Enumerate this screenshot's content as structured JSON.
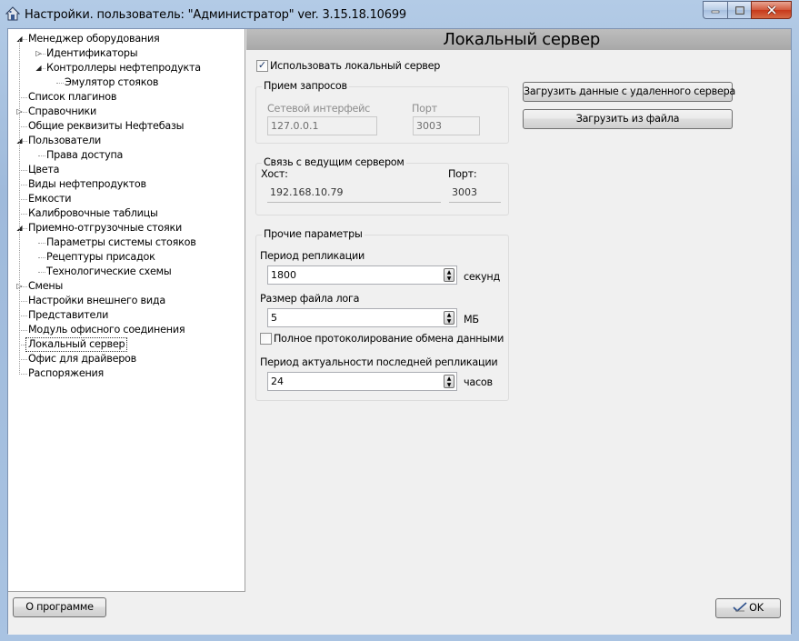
{
  "window": {
    "title": "Настройки. пользователь: \"Администратор\" ver. 3.15.18.10699"
  },
  "tree": [
    {
      "label": "Менеджер оборудования",
      "level": 0,
      "exp": "open"
    },
    {
      "label": "Идентификаторы",
      "level": 1,
      "exp": "closed"
    },
    {
      "label": "Контроллеры нефтепродукта",
      "level": 1,
      "exp": "open"
    },
    {
      "label": "Эмулятор стояков",
      "level": 2,
      "exp": ""
    },
    {
      "label": "Список плагинов",
      "level": 0,
      "exp": ""
    },
    {
      "label": "Справочники",
      "level": 0,
      "exp": "closed"
    },
    {
      "label": "Общие реквизиты Нефтебазы",
      "level": 0,
      "exp": ""
    },
    {
      "label": "Пользователи",
      "level": 0,
      "exp": "open"
    },
    {
      "label": "Права доступа",
      "level": 1,
      "exp": ""
    },
    {
      "label": "Цвета",
      "level": 0,
      "exp": ""
    },
    {
      "label": "Виды нефтепродуктов",
      "level": 0,
      "exp": ""
    },
    {
      "label": "Емкости",
      "level": 0,
      "exp": ""
    },
    {
      "label": "Калибровочные таблицы",
      "level": 0,
      "exp": ""
    },
    {
      "label": "Приемно-отгрузочные стояки",
      "level": 0,
      "exp": "open"
    },
    {
      "label": "Параметры системы стояков",
      "level": 1,
      "exp": ""
    },
    {
      "label": "Рецептуры присадок",
      "level": 1,
      "exp": ""
    },
    {
      "label": "Технологические схемы",
      "level": 1,
      "exp": ""
    },
    {
      "label": "Смены",
      "level": 0,
      "exp": "closed"
    },
    {
      "label": "Настройки внешнего вида",
      "level": 0,
      "exp": ""
    },
    {
      "label": "Представители",
      "level": 0,
      "exp": ""
    },
    {
      "label": "Модуль офисного соединения",
      "level": 0,
      "exp": ""
    },
    {
      "label": "Локальный сервер",
      "level": 0,
      "exp": "",
      "selected": true
    },
    {
      "label": "Офис для драйверов",
      "level": 0,
      "exp": ""
    },
    {
      "label": "Распоряжения",
      "level": 0,
      "exp": ""
    }
  ],
  "panel": {
    "title": "Локальный сервер",
    "use_local": {
      "label": "Использовать локальный сервер",
      "checked": true
    },
    "requests": {
      "legend": "Прием запросов",
      "iface_label": "Сетевой интерфейс",
      "iface_value": "127.0.0.1",
      "port_label": "Порт",
      "port_value": "3003"
    },
    "master": {
      "legend": "Связь с ведущим сервером",
      "host_label": "Хост:",
      "host_value": "192.168.10.79",
      "port_label": "Порт:",
      "port_value": "3003"
    },
    "other": {
      "legend": "Прочие параметры",
      "replication_label": "Период репликации",
      "replication_value": "1800",
      "replication_unit": "секунд",
      "log_label": "Размер файла лога",
      "log_value": "5",
      "log_unit": "МБ",
      "full_log": {
        "label": "Полное протоколирование обмена данными",
        "checked": false
      },
      "actuality_label": "Период актуальности последней репликации",
      "actuality_value": "24",
      "actuality_unit": "часов"
    },
    "load_remote_label": "Загрузить данные с удаленного сервера",
    "load_file_label": "Загрузить из файла"
  },
  "footer": {
    "about_label": "О программе",
    "ok_label": "OK"
  },
  "icons": {
    "app": "house-icon",
    "ok": "checkmark-pen-icon",
    "check_glyph": "✓",
    "spin_up": "▲",
    "spin_down": "▼",
    "exp_open": "◢",
    "exp_closed": "▷"
  }
}
